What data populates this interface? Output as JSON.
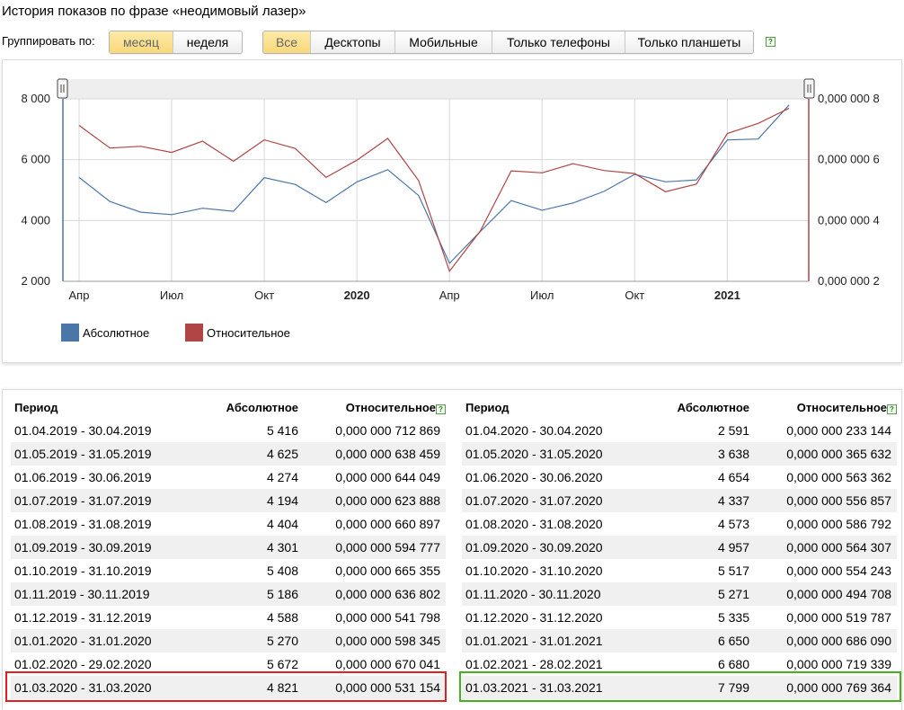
{
  "title": "История показов по фразе «неодимовый лазер»",
  "group_label": "Группировать по:",
  "group_buttons": [
    "месяц",
    "неделя"
  ],
  "device_buttons": [
    "Все",
    "Десктопы",
    "Мобильные",
    "Только телефоны",
    "Только планшеты"
  ],
  "help_icon": "?",
  "colors": {
    "absolute": "#4a76a8",
    "relative": "#b04545",
    "active_button": "#f8d87a",
    "highlight_red": "#e02020",
    "highlight_green": "#46b11e"
  },
  "legend": {
    "absolute": "Абсолютное",
    "relative": "Относительное"
  },
  "chart_data": {
    "type": "line",
    "x": [
      "2019-04",
      "2019-05",
      "2019-06",
      "2019-07",
      "2019-08",
      "2019-09",
      "2019-10",
      "2019-11",
      "2019-12",
      "2020-01",
      "2020-02",
      "2020-03",
      "2020-04",
      "2020-05",
      "2020-06",
      "2020-07",
      "2020-08",
      "2020-09",
      "2020-10",
      "2020-11",
      "2020-12",
      "2021-01",
      "2021-02",
      "2021-03"
    ],
    "x_ticks": [
      "Апр",
      "Июл",
      "Окт",
      "2020",
      "Апр",
      "Июл",
      "Окт",
      "2021"
    ],
    "y_left_ticks": [
      "2 000",
      "4 000",
      "6 000",
      "8 000"
    ],
    "y_right_ticks": [
      "0,000 000 2",
      "0,000 000 4",
      "0,000 000 6",
      "0,000 000 8"
    ],
    "y_left_range": [
      2000,
      8000
    ],
    "y_right_range": [
      2e-07,
      8e-07
    ],
    "series": [
      {
        "name": "Абсолютное",
        "axis": "left",
        "values": [
          5416,
          4625,
          4274,
          4194,
          4404,
          4301,
          5408,
          5186,
          4588,
          5270,
          5672,
          4821,
          2591,
          3638,
          4654,
          4337,
          4573,
          4957,
          5517,
          5271,
          5335,
          6650,
          6680,
          7799
        ]
      },
      {
        "name": "Относительное",
        "axis": "right",
        "values": [
          7.12869e-07,
          6.38459e-07,
          6.44049e-07,
          6.23888e-07,
          6.60897e-07,
          5.94777e-07,
          6.65355e-07,
          6.36802e-07,
          5.41798e-07,
          5.98345e-07,
          6.70041e-07,
          5.31154e-07,
          2.33144e-07,
          3.65632e-07,
          5.63362e-07,
          5.56857e-07,
          5.86792e-07,
          5.64307e-07,
          5.54243e-07,
          4.94708e-07,
          5.19787e-07,
          6.8609e-07,
          7.19339e-07,
          7.69364e-07
        ]
      }
    ]
  },
  "table_headers": {
    "period": "Период",
    "absolute": "Абсолютное",
    "relative": "Относительное"
  },
  "table_left": [
    [
      "01.04.2019 - 30.04.2019",
      "5 416",
      "0,000 000 712 869"
    ],
    [
      "01.05.2019 - 31.05.2019",
      "4 625",
      "0,000 000 638 459"
    ],
    [
      "01.06.2019 - 30.06.2019",
      "4 274",
      "0,000 000 644 049"
    ],
    [
      "01.07.2019 - 31.07.2019",
      "4 194",
      "0,000 000 623 888"
    ],
    [
      "01.08.2019 - 31.08.2019",
      "4 404",
      "0,000 000 660 897"
    ],
    [
      "01.09.2019 - 30.09.2019",
      "4 301",
      "0,000 000 594 777"
    ],
    [
      "01.10.2019 - 31.10.2019",
      "5 408",
      "0,000 000 665 355"
    ],
    [
      "01.11.2019 - 30.11.2019",
      "5 186",
      "0,000 000 636 802"
    ],
    [
      "01.12.2019 - 31.12.2019",
      "4 588",
      "0,000 000 541 798"
    ],
    [
      "01.01.2020 - 31.01.2020",
      "5 270",
      "0,000 000 598 345"
    ],
    [
      "01.02.2020 - 29.02.2020",
      "5 672",
      "0,000 000 670 041"
    ],
    [
      "01.03.2020 - 31.03.2020",
      "4 821",
      "0,000 000 531 154"
    ]
  ],
  "table_right": [
    [
      "01.04.2020 - 30.04.2020",
      "2 591",
      "0,000 000 233 144"
    ],
    [
      "01.05.2020 - 31.05.2020",
      "3 638",
      "0,000 000 365 632"
    ],
    [
      "01.06.2020 - 30.06.2020",
      "4 654",
      "0,000 000 563 362"
    ],
    [
      "01.07.2020 - 31.07.2020",
      "4 337",
      "0,000 000 556 857"
    ],
    [
      "01.08.2020 - 31.08.2020",
      "4 573",
      "0,000 000 586 792"
    ],
    [
      "01.09.2020 - 30.09.2020",
      "4 957",
      "0,000 000 564 307"
    ],
    [
      "01.10.2020 - 31.10.2020",
      "5 517",
      "0,000 000 554 243"
    ],
    [
      "01.11.2020 - 30.11.2020",
      "5 271",
      "0,000 000 494 708"
    ],
    [
      "01.12.2020 - 31.12.2020",
      "5 335",
      "0,000 000 519 787"
    ],
    [
      "01.01.2021 - 31.01.2021",
      "6 650",
      "0,000 000 686 090"
    ],
    [
      "01.02.2021 - 28.02.2021",
      "6 680",
      "0,000 000 719 339"
    ],
    [
      "01.03.2021 - 31.03.2021",
      "7 799",
      "0,000 000 769 364"
    ]
  ]
}
